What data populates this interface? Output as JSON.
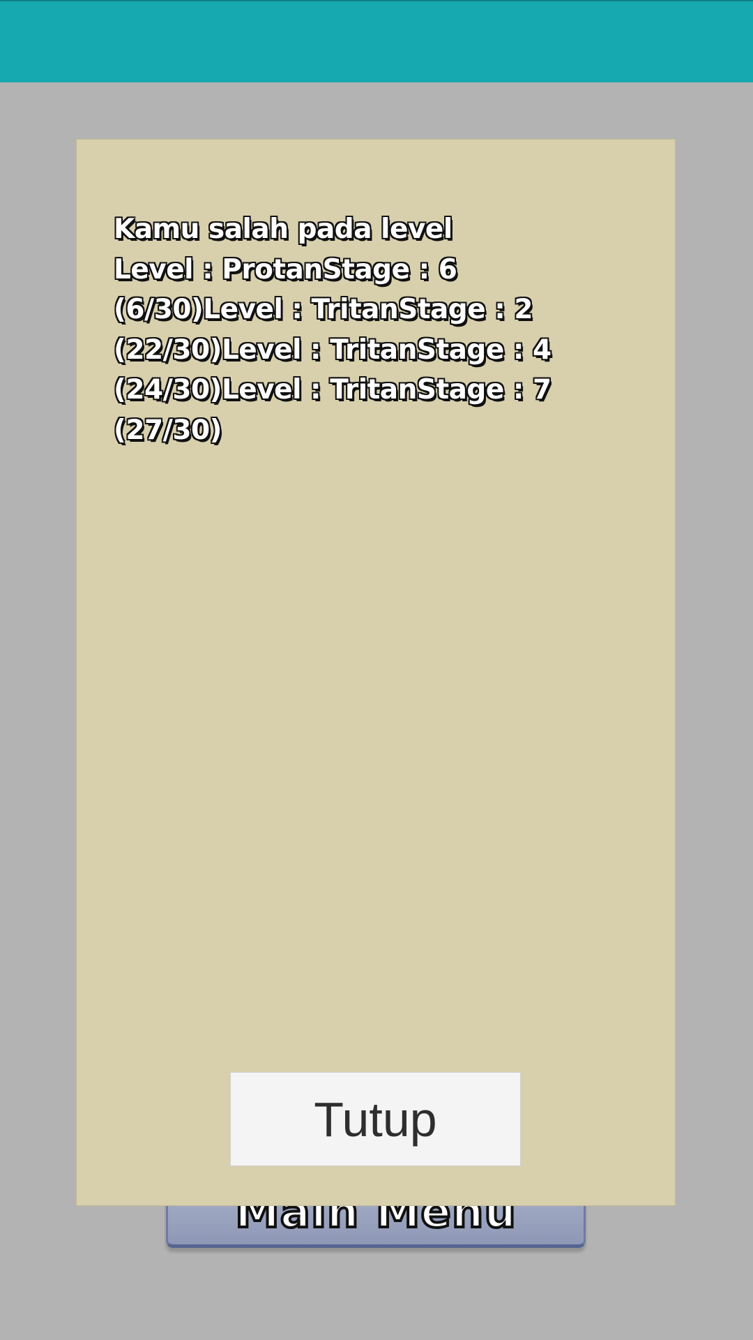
{
  "background": {
    "top_bar_color": "#17a9b0",
    "screen_color": "#b3b3b3"
  },
  "main_menu_button": {
    "label": "Main Menu",
    "color": "#9aa3c0"
  },
  "dialog": {
    "background_color": "#d8cfad",
    "message_lines": [
      "Kamu salah pada level",
      "Level : ProtanStage : 6",
      "(6/30)Level : TritanStage : 2",
      "(22/30)Level : TritanStage : 4",
      "(24/30)Level : TritanStage : 7",
      "(27/30)"
    ],
    "close_button_label": "Tutup"
  }
}
